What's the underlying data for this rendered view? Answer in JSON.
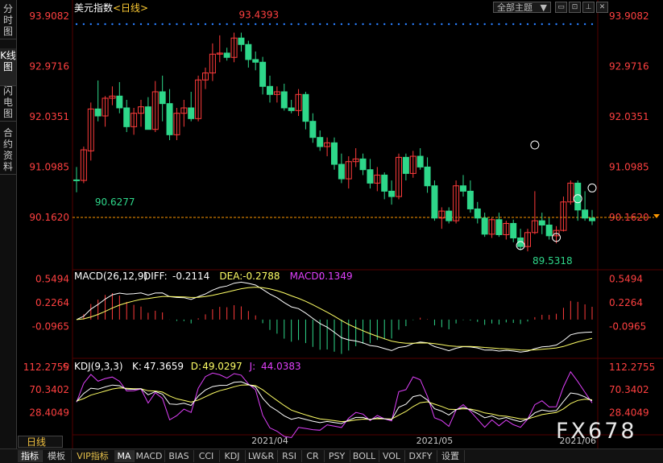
{
  "sidebar": {
    "tabs": [
      {
        "label": "分时图",
        "active": false
      },
      {
        "label": "K线图",
        "active": true
      },
      {
        "label": "闪电图",
        "active": false
      },
      {
        "label": "合约资料",
        "active": false
      }
    ]
  },
  "toolbar": {
    "theme_label": "全部主题",
    "theme_icon": "triangle-down-icon"
  },
  "period_label": "日线",
  "watermark": "FX678",
  "bottom_tabs": [
    {
      "label": "指标",
      "active": true
    },
    {
      "label": "模板",
      "active": false
    },
    {
      "label": "VIP指标",
      "active": false,
      "vip": true
    },
    {
      "label": "MA",
      "active": true
    },
    {
      "label": "MACD",
      "active": false
    },
    {
      "label": "BIAS",
      "active": false
    },
    {
      "label": "CCI",
      "active": false
    },
    {
      "label": "KDJ",
      "active": false
    },
    {
      "label": "LW&R",
      "active": false
    },
    {
      "label": "RSI",
      "active": false
    },
    {
      "label": "CR",
      "active": false
    },
    {
      "label": "PSY",
      "active": false
    },
    {
      "label": "BOLL",
      "active": false
    },
    {
      "label": "VOL",
      "active": false
    },
    {
      "label": "DXFY",
      "active": false
    },
    {
      "label": "设置",
      "active": false
    }
  ],
  "colors": {
    "up": "#ff3b3b",
    "down": "#2ed78a",
    "axis_text": "#ff4040",
    "kdj_k": "#ffffff",
    "kdj_d": "#ffff66",
    "kdj_j": "#e040fb",
    "diff": "#ffffff",
    "dea": "#ffff66",
    "grid": "#550000",
    "dots": "#2a7fff",
    "current_line": "#ff9900"
  },
  "chart_data": [
    {
      "type": "candlestick",
      "title": "美元指数",
      "period": "<日线>",
      "y_ticks": [
        "93.9082",
        "92.9716",
        "92.0351",
        "91.0985",
        "90.1620"
      ],
      "ylim": [
        89.25,
        94.0
      ],
      "x_ticks": [
        "2021/04",
        "2021/05",
        "2021/06"
      ],
      "annotations": {
        "high": "93.4393",
        "low": "89.5318",
        "start_low": "90.6277"
      },
      "current_value": 90.162,
      "ohlc": [
        [
          90.86,
          91.1,
          90.63,
          90.85
        ],
        [
          90.85,
          91.48,
          90.8,
          91.42
        ],
        [
          91.4,
          92.3,
          91.22,
          92.18
        ],
        [
          92.18,
          92.71,
          91.95,
          92.05
        ],
        [
          92.05,
          92.42,
          91.85,
          92.38
        ],
        [
          92.38,
          92.6,
          92.25,
          92.42
        ],
        [
          92.42,
          92.68,
          92.1,
          92.2
        ],
        [
          92.2,
          92.35,
          91.75,
          91.85
        ],
        [
          91.85,
          92.2,
          91.7,
          92.1
        ],
        [
          92.1,
          92.35,
          91.85,
          92.22
        ],
        [
          92.22,
          92.4,
          91.95,
          91.8
        ],
        [
          91.8,
          92.7,
          91.75,
          92.5
        ],
        [
          92.5,
          92.8,
          91.95,
          92.28
        ],
        [
          92.28,
          92.55,
          91.6,
          91.7
        ],
        [
          91.7,
          92.2,
          91.6,
          92.1
        ],
        [
          92.1,
          92.35,
          91.85,
          92.2
        ],
        [
          92.2,
          92.5,
          91.95,
          92.0
        ],
        [
          92.0,
          92.8,
          91.95,
          92.72
        ],
        [
          92.72,
          92.95,
          92.55,
          92.85
        ],
        [
          92.85,
          93.4,
          92.7,
          93.2
        ],
        [
          93.2,
          93.55,
          93.05,
          93.22
        ],
        [
          93.22,
          93.32,
          93.08,
          93.14
        ],
        [
          93.14,
          93.6,
          93.05,
          93.5
        ],
        [
          93.5,
          93.6,
          93.25,
          93.38
        ],
        [
          93.38,
          93.45,
          92.95,
          93.1
        ],
        [
          93.1,
          93.25,
          92.9,
          93.05
        ],
        [
          93.05,
          93.15,
          92.45,
          92.6
        ],
        [
          92.6,
          92.8,
          92.3,
          92.45
        ],
        [
          92.45,
          92.6,
          92.3,
          92.5
        ],
        [
          92.5,
          92.65,
          92.15,
          92.2
        ],
        [
          92.2,
          92.35,
          92.1,
          92.15
        ],
        [
          92.15,
          92.55,
          92.05,
          92.45
        ],
        [
          92.45,
          92.5,
          91.8,
          91.95
        ],
        [
          91.95,
          92.1,
          91.55,
          91.65
        ],
        [
          91.65,
          91.78,
          91.4,
          91.48
        ],
        [
          91.48,
          91.65,
          91.3,
          91.55
        ],
        [
          91.55,
          91.65,
          91.05,
          91.15
        ],
        [
          91.15,
          91.35,
          90.8,
          90.88
        ],
        [
          90.88,
          91.3,
          90.7,
          91.2
        ],
        [
          91.2,
          91.45,
          91.1,
          91.25
        ],
        [
          91.25,
          91.35,
          90.95,
          91.05
        ],
        [
          91.05,
          91.25,
          90.7,
          90.8
        ],
        [
          90.8,
          91.1,
          90.65,
          90.95
        ],
        [
          90.95,
          91.0,
          90.5,
          90.65
        ],
        [
          90.65,
          90.85,
          90.4,
          90.55
        ],
        [
          90.55,
          91.35,
          90.5,
          91.28
        ],
        [
          91.28,
          91.35,
          90.85,
          90.98
        ],
        [
          90.98,
          91.4,
          90.9,
          91.3
        ],
        [
          91.3,
          91.45,
          91.05,
          91.1
        ],
        [
          91.1,
          91.28,
          90.62,
          90.75
        ],
        [
          90.75,
          90.85,
          90.1,
          90.15
        ],
        [
          90.15,
          90.35,
          89.95,
          90.28
        ],
        [
          90.28,
          90.35,
          90.05,
          90.1
        ],
        [
          90.1,
          90.85,
          90.05,
          90.75
        ],
        [
          90.75,
          90.95,
          90.55,
          90.65
        ],
        [
          90.65,
          90.85,
          90.25,
          90.32
        ],
        [
          90.32,
          90.45,
          90.05,
          90.15
        ],
        [
          90.15,
          90.25,
          89.8,
          89.85
        ],
        [
          89.85,
          90.15,
          89.78,
          90.12
        ],
        [
          90.12,
          90.25,
          89.8,
          89.84
        ],
        [
          89.84,
          90.1,
          89.75,
          90.05
        ],
        [
          90.05,
          90.12,
          89.7,
          89.78
        ],
        [
          89.78,
          89.95,
          89.55,
          89.62
        ],
        [
          89.62,
          89.95,
          89.53,
          89.88
        ],
        [
          89.88,
          90.65,
          89.85,
          90.1
        ],
        [
          90.1,
          90.25,
          89.85,
          90.02
        ],
        [
          90.02,
          90.15,
          89.75,
          89.82
        ],
        [
          89.82,
          90.0,
          89.68,
          89.92
        ],
        [
          89.92,
          90.55,
          89.9,
          90.45
        ],
        [
          90.45,
          90.85,
          90.4,
          90.8
        ],
        [
          90.8,
          90.85,
          90.1,
          90.3
        ],
        [
          90.3,
          90.65,
          90.1,
          90.15
        ],
        [
          90.15,
          90.3,
          90.02,
          90.1
        ]
      ]
    },
    {
      "type": "bar+line",
      "title": "MACD(26,12,9)",
      "legend": [
        {
          "name": "DIFF",
          "value": "-0.2114"
        },
        {
          "name": "DEA",
          "value": "-0.2788"
        },
        {
          "name": "MACD",
          "value": "0.1349"
        }
      ],
      "y_ticks": [
        "0.5494",
        "0.2264",
        "-0.0965"
      ],
      "ylim": [
        -0.47,
        0.62
      ]
    },
    {
      "type": "line",
      "title": "KDJ(9,3,3)",
      "legend": [
        {
          "name": "K",
          "value": "47.3659"
        },
        {
          "name": "D",
          "value": "49.0297"
        },
        {
          "name": "J",
          "value": "44.0383"
        }
      ],
      "y_ticks": [
        "112.2755",
        "70.3402",
        "28.4049"
      ],
      "ylim": [
        -8,
        118
      ]
    }
  ]
}
